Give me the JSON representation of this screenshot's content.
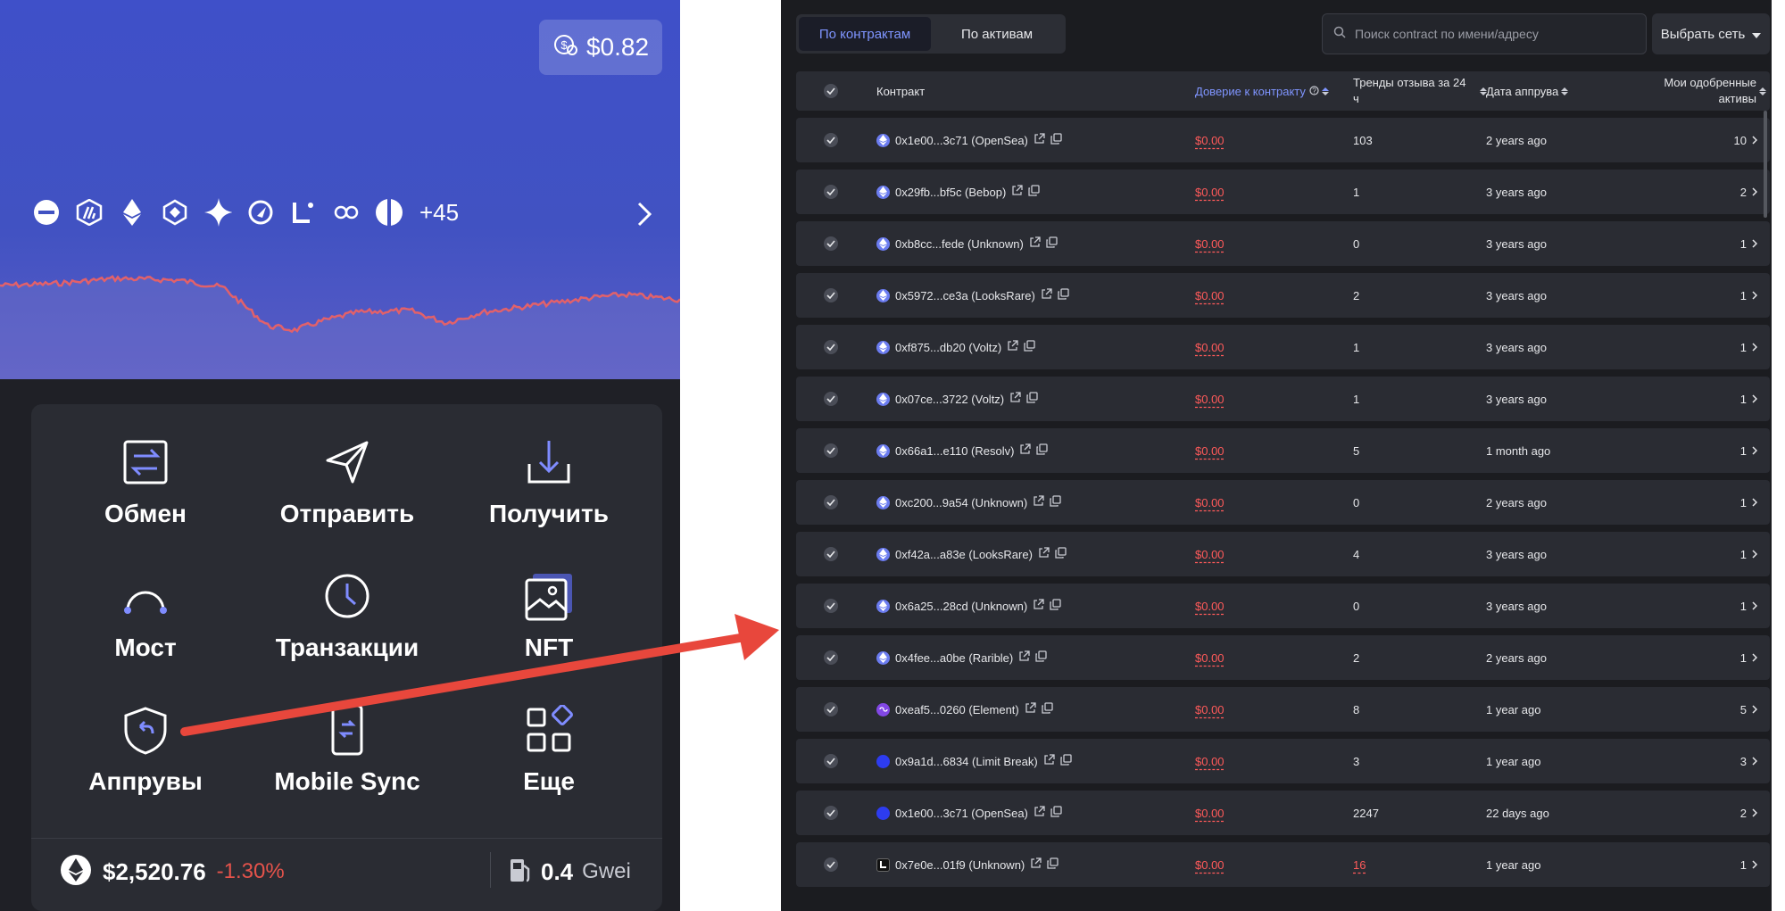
{
  "wallet": {
    "balance": "$0.82",
    "chains_more": "+45",
    "actions": [
      {
        "label": "Обмен",
        "icon": "swap-icon"
      },
      {
        "label": "Отправить",
        "icon": "send-icon"
      },
      {
        "label": "Получить",
        "icon": "receive-icon"
      },
      {
        "label": "Мост",
        "icon": "bridge-icon"
      },
      {
        "label": "Транзакции",
        "icon": "clock-icon"
      },
      {
        "label": "NFT",
        "icon": "nft-image-icon"
      },
      {
        "label": "Аппрувы",
        "icon": "shield-icon"
      },
      {
        "label": "Mobile Sync",
        "icon": "phone-icon"
      },
      {
        "label": "Еще",
        "icon": "grid-icon"
      }
    ],
    "eth_price": "$2,520.76",
    "eth_change": "-1.30%",
    "gas_value": "0.4",
    "gas_unit": "Gwei"
  },
  "approvals": {
    "tabs": [
      "По контрактам",
      "По активам"
    ],
    "active_tab": 0,
    "search_placeholder": "Поиск contract по имени/адресу",
    "network_select": "Выбрать сеть",
    "columns": {
      "contract": "Контракт",
      "trust": "Доверие к контракту",
      "trend_line1": "Тренды отзыва за 24",
      "trend_line2": "ч",
      "date": "Дата аппрува",
      "assets_line1": "Мои одобренные",
      "assets_line2": "активы"
    },
    "rows": [
      {
        "contract": "0x1e00...3c71 (OpenSea)",
        "token": "eth",
        "trust": "$0.00",
        "trend": "103",
        "date": "2 years ago",
        "count": "10",
        "trend_red": false
      },
      {
        "contract": "0x29fb...bf5c (Bebop)",
        "token": "eth",
        "trust": "$0.00",
        "trend": "1",
        "date": "3 years ago",
        "count": "2",
        "trend_red": false
      },
      {
        "contract": "0xb8cc...fede (Unknown)",
        "token": "eth",
        "trust": "$0.00",
        "trend": "0",
        "date": "3 years ago",
        "count": "1",
        "trend_red": false
      },
      {
        "contract": "0x5972...ce3a (LooksRare)",
        "token": "eth",
        "trust": "$0.00",
        "trend": "2",
        "date": "3 years ago",
        "count": "1",
        "trend_red": false
      },
      {
        "contract": "0xf875...db20 (Voltz)",
        "token": "eth",
        "trust": "$0.00",
        "trend": "1",
        "date": "3 years ago",
        "count": "1",
        "trend_red": false
      },
      {
        "contract": "0x07ce...3722 (Voltz)",
        "token": "eth",
        "trust": "$0.00",
        "trend": "1",
        "date": "3 years ago",
        "count": "1",
        "trend_red": false
      },
      {
        "contract": "0x66a1...e110 (Resolv)",
        "token": "eth",
        "trust": "$0.00",
        "trend": "5",
        "date": "1 month ago",
        "count": "1",
        "trend_red": false
      },
      {
        "contract": "0xc200...9a54 (Unknown)",
        "token": "eth",
        "trust": "$0.00",
        "trend": "0",
        "date": "2 years ago",
        "count": "1",
        "trend_red": false
      },
      {
        "contract": "0xf42a...a83e (LooksRare)",
        "token": "eth",
        "trust": "$0.00",
        "trend": "4",
        "date": "3 years ago",
        "count": "1",
        "trend_red": false
      },
      {
        "contract": "0x6a25...28cd (Unknown)",
        "token": "eth",
        "trust": "$0.00",
        "trend": "0",
        "date": "3 years ago",
        "count": "1",
        "trend_red": false
      },
      {
        "contract": "0x4fee...a0be (Rarible)",
        "token": "eth",
        "trust": "$0.00",
        "trend": "2",
        "date": "2 years ago",
        "count": "1",
        "trend_red": false
      },
      {
        "contract": "0xeaf5...0260 (Element)",
        "token": "polygon",
        "trust": "$0.00",
        "trend": "8",
        "date": "1 year ago",
        "count": "5",
        "trend_red": false
      },
      {
        "contract": "0x9a1d...6834 (Limit Break)",
        "token": "blue",
        "trust": "$0.00",
        "trend": "3",
        "date": "1 year ago",
        "count": "3",
        "trend_red": false
      },
      {
        "contract": "0x1e00...3c71 (OpenSea)",
        "token": "blue",
        "trust": "$0.00",
        "trend": "2247",
        "date": "22 days ago",
        "count": "2",
        "trend_red": false
      },
      {
        "contract": "0x7e0e...01f9 (Unknown)",
        "token": "linea",
        "trust": "$0.00",
        "trend": "16",
        "date": "1 year ago",
        "count": "1",
        "trend_red": true
      }
    ]
  },
  "colors": {
    "hero": "#4152c2",
    "accent": "#7f95ff",
    "danger": "#ff5a5a",
    "arrow": "#e8473c"
  }
}
